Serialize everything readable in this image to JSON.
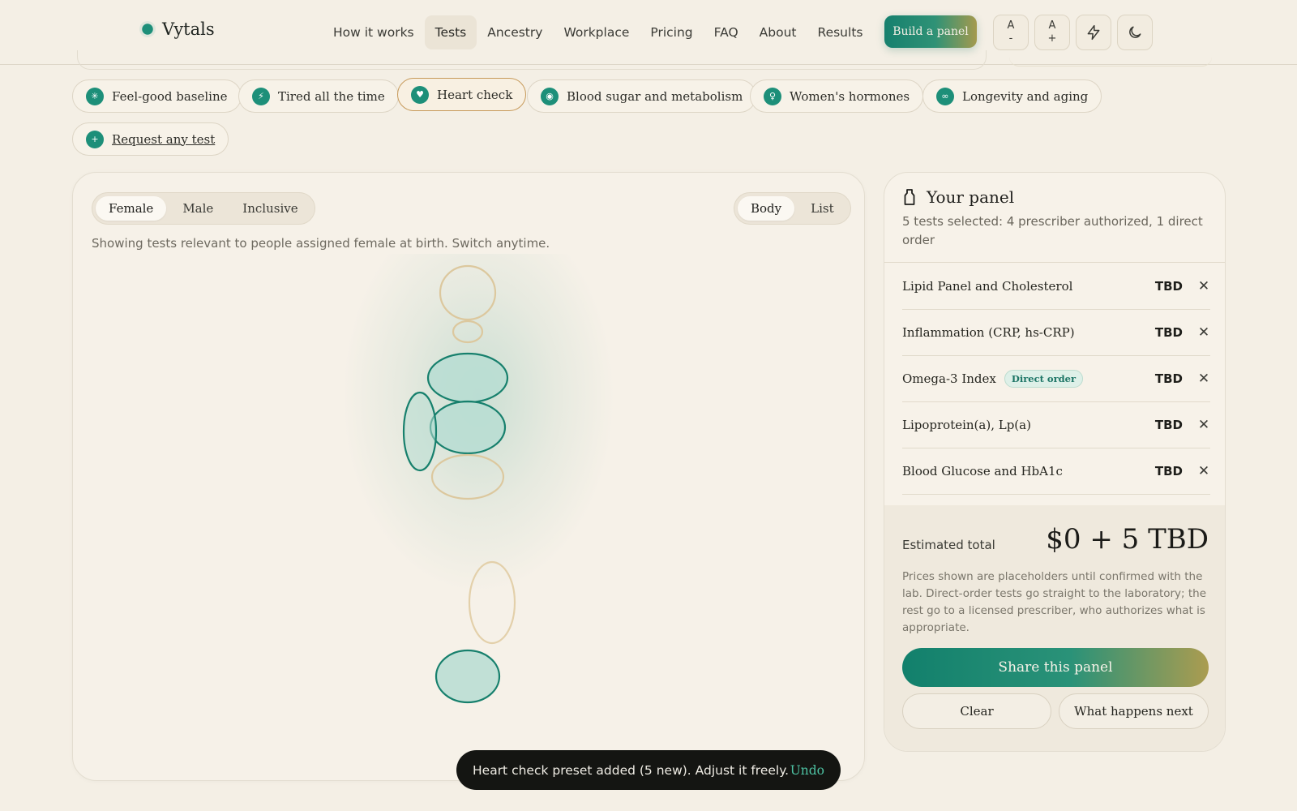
{
  "header": {
    "brand": "Vytals",
    "nav": [
      "How it works",
      "Tests",
      "Ancestry",
      "Workplace",
      "Pricing",
      "FAQ",
      "About",
      "Results"
    ],
    "active_nav": "Tests",
    "cta": "Build a panel",
    "tools": {
      "font_decrease": {
        "top": "A",
        "bottom": "-"
      },
      "font_increase": {
        "top": "A",
        "bottom": "+"
      },
      "lightning_icon": "lightning-icon",
      "theme_icon": "moon-icon"
    }
  },
  "presets": [
    {
      "label": "Feel-good baseline",
      "icon": "✳",
      "active": false
    },
    {
      "label": "Tired all the time",
      "icon": "⚡",
      "active": false
    },
    {
      "label": "Heart check",
      "icon": "♥",
      "active": true
    },
    {
      "label": "Blood sugar and metabolism",
      "icon": "◉",
      "active": false
    },
    {
      "label": "Women's hormones",
      "icon": "♀",
      "active": false
    },
    {
      "label": "Longevity and aging",
      "icon": "∞",
      "active": false
    }
  ],
  "request_chip": {
    "label": "Request any test",
    "icon": "+"
  },
  "body_view": {
    "sex_options": [
      "Female",
      "Male",
      "Inclusive"
    ],
    "sex_selected": "Female",
    "view_options": [
      "Body",
      "List"
    ],
    "view_selected": "Body",
    "helper": "Showing tests relevant to people assigned female at birth. Switch anytime."
  },
  "panel": {
    "title": "Your panel",
    "subtitle": "5 tests selected: 4 prescriber authorized, 1 direct order",
    "items": [
      {
        "name": "Lipid Panel and Cholesterol",
        "badge": "",
        "price": "TBD"
      },
      {
        "name": "Inflammation (CRP, hs-CRP)",
        "badge": "",
        "price": "TBD"
      },
      {
        "name": "Omega-3 Index",
        "badge": "Direct order",
        "price": "TBD"
      },
      {
        "name": "Lipoprotein(a), Lp(a)",
        "badge": "",
        "price": "TBD"
      },
      {
        "name": "Blood Glucose and HbA1c",
        "badge": "",
        "price": "TBD"
      }
    ],
    "remove_glyph": "✕",
    "estimated_label": "Estimated total",
    "estimated_value": "$0 + 5 TBD",
    "disclaimer": "Prices shown are placeholders until confirmed with the lab. Direct-order tests go straight to the laboratory; the rest go to a licensed prescriber, who authorizes what is appropriate.",
    "share_label": "Share this panel",
    "clear_label": "Clear",
    "next_label": "What happens next"
  },
  "toast": {
    "message": "Heart check preset added (5 new). Adjust it freely.",
    "action": "Undo"
  },
  "colors": {
    "accent": "#1d8f79",
    "background": "#f4efe5",
    "active_organ_fill": "#b7ddd2",
    "inactive_organ_stroke": "#dcc89e"
  }
}
